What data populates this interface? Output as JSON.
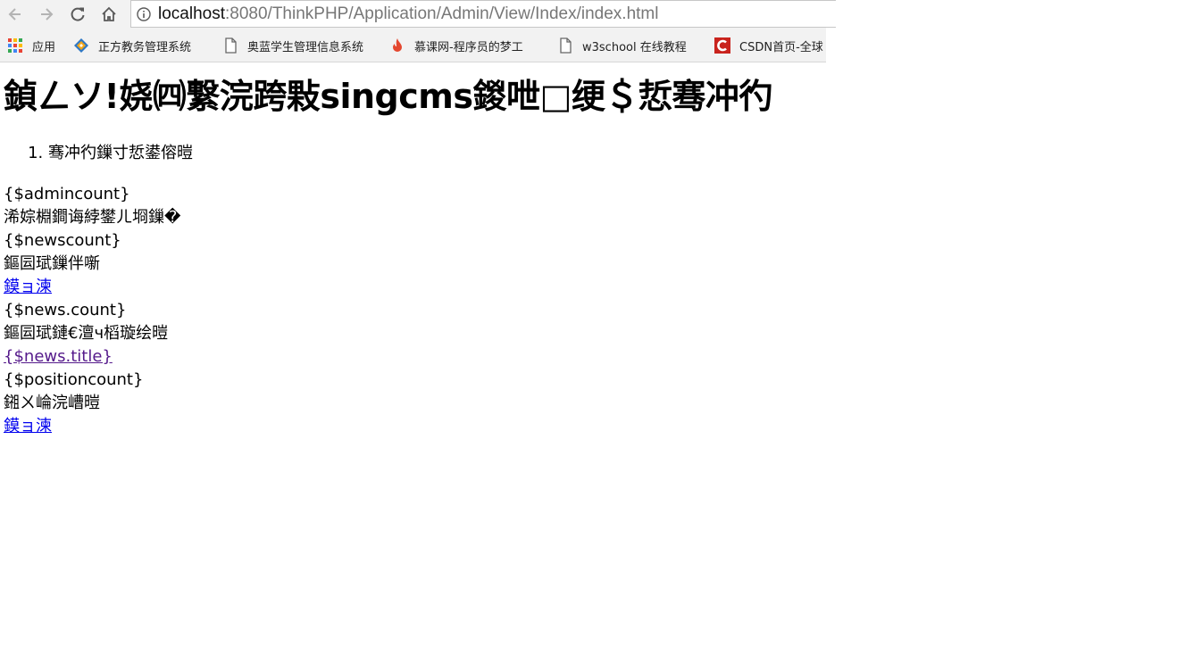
{
  "browser": {
    "url_host": "localhost",
    "url_rest": ":8080/ThinkPHP/Application/Admin/View/Index/index.html",
    "bookmarks": [
      {
        "icon": "apps-grid-icon",
        "label": "应用"
      },
      {
        "icon": "zhengfang-logo-icon",
        "label": "正方教务管理系统"
      },
      {
        "icon": "page-icon",
        "label": "奥蓝学生管理信息系统"
      },
      {
        "icon": "flame-icon",
        "label": "慕课网-程序员的梦工"
      },
      {
        "icon": "page-icon",
        "label": "w3school 在线教程"
      },
      {
        "icon": "csdn-logo-icon",
        "label": "CSDN首页-全球"
      }
    ],
    "colors": {
      "csdn_red": "#c9231d",
      "flame": "#e4472f"
    }
  },
  "page": {
    "title": "鍞ㄥソ!娆㈣繋浣跨敤singcms鍐呭□绠＄悊骞冲彴",
    "menu_items": [
      "骞冲彴鏁寸悊鍙傛暟"
    ],
    "lines": [
      {
        "text": "{$admincount}",
        "link": false
      },
      {
        "text": "浠婃棩鐧诲綍鐢ㄦ埛鏁�",
        "link": false
      },
      {
        "text": "{$newscount}",
        "link": false
      },
      {
        "text": "鏂囩珷鏁伴噺",
        "link": false
      },
      {
        "text": "鏌ョ湅",
        "link": true,
        "visited": false
      },
      {
        "text": "{$news.count}",
        "link": false
      },
      {
        "text": "鏂囩珷鏈€澶ч槄璇绘暟",
        "link": false
      },
      {
        "text": "{$news.title}",
        "link": true,
        "visited": true
      },
      {
        "text": "{$positioncount}",
        "link": false
      },
      {
        "text": "鎺ㄨ崘浣嶆暟",
        "link": false
      },
      {
        "text": "鏌ョ湅",
        "link": true,
        "visited": false
      }
    ]
  }
}
